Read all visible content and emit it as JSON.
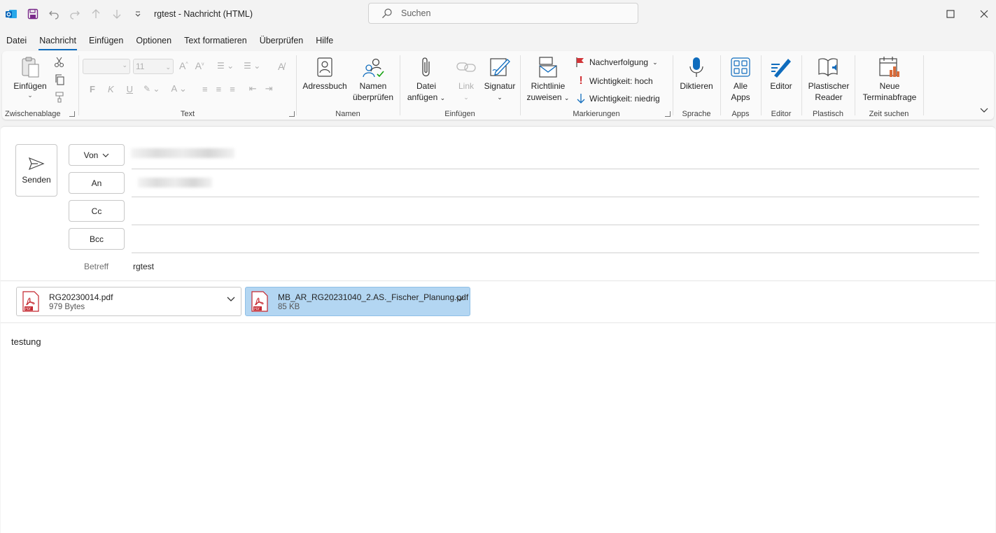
{
  "titlebar": {
    "window_title": "rgtest  -  Nachricht (HTML)",
    "search_placeholder": "Suchen"
  },
  "menu": {
    "tabs": [
      "Datei",
      "Nachricht",
      "Einfügen",
      "Optionen",
      "Text formatieren",
      "Überprüfen",
      "Hilfe"
    ],
    "active": "Nachricht"
  },
  "ribbon": {
    "clipboard": {
      "paste": "Einfügen",
      "label": "Zwischenablage"
    },
    "text": {
      "font_size": "11",
      "bold": "F",
      "italic": "K",
      "underline": "U",
      "label": "Text"
    },
    "names": {
      "address_book": "Adressbuch",
      "check_names_1": "Namen",
      "check_names_2": "überprüfen",
      "label": "Namen"
    },
    "insert": {
      "attach_1": "Datei",
      "attach_2": "anfügen",
      "link": "Link",
      "signature": "Signatur",
      "label": "Einfügen"
    },
    "tags": {
      "policy_1": "Richtlinie",
      "policy_2": "zuweisen",
      "followup": "Nachverfolgung",
      "high": "Wichtigkeit: hoch",
      "low": "Wichtigkeit: niedrig",
      "label": "Markierungen"
    },
    "voice": {
      "dictate": "Diktieren",
      "label": "Sprache"
    },
    "apps": {
      "all_1": "Alle",
      "all_2": "Apps",
      "label": "Apps"
    },
    "editor": {
      "editor": "Editor",
      "label": "Editor"
    },
    "immersive": {
      "reader_1": "Plastischer",
      "reader_2": "Reader",
      "label": "Plastisch"
    },
    "schedule": {
      "poll_1": "Neue",
      "poll_2": "Terminabfrage",
      "label": "Zeit suchen"
    }
  },
  "compose": {
    "send": "Senden",
    "from": "Von",
    "to": "An",
    "cc": "Cc",
    "bcc": "Bcc",
    "subject_label": "Betreff",
    "subject_value": "rgtest",
    "body": "testung"
  },
  "attachments": [
    {
      "name": "RG20230014.pdf",
      "size": "979 Bytes",
      "selected": false
    },
    {
      "name": "MB_AR_RG20231040_2.AS._Fischer_Planung.pdf",
      "size": "85 KB",
      "selected": true
    }
  ],
  "colors": {
    "accent": "#0f6cbd",
    "selected_attachment": "#b3d6f2",
    "flag_red": "#d13438"
  }
}
